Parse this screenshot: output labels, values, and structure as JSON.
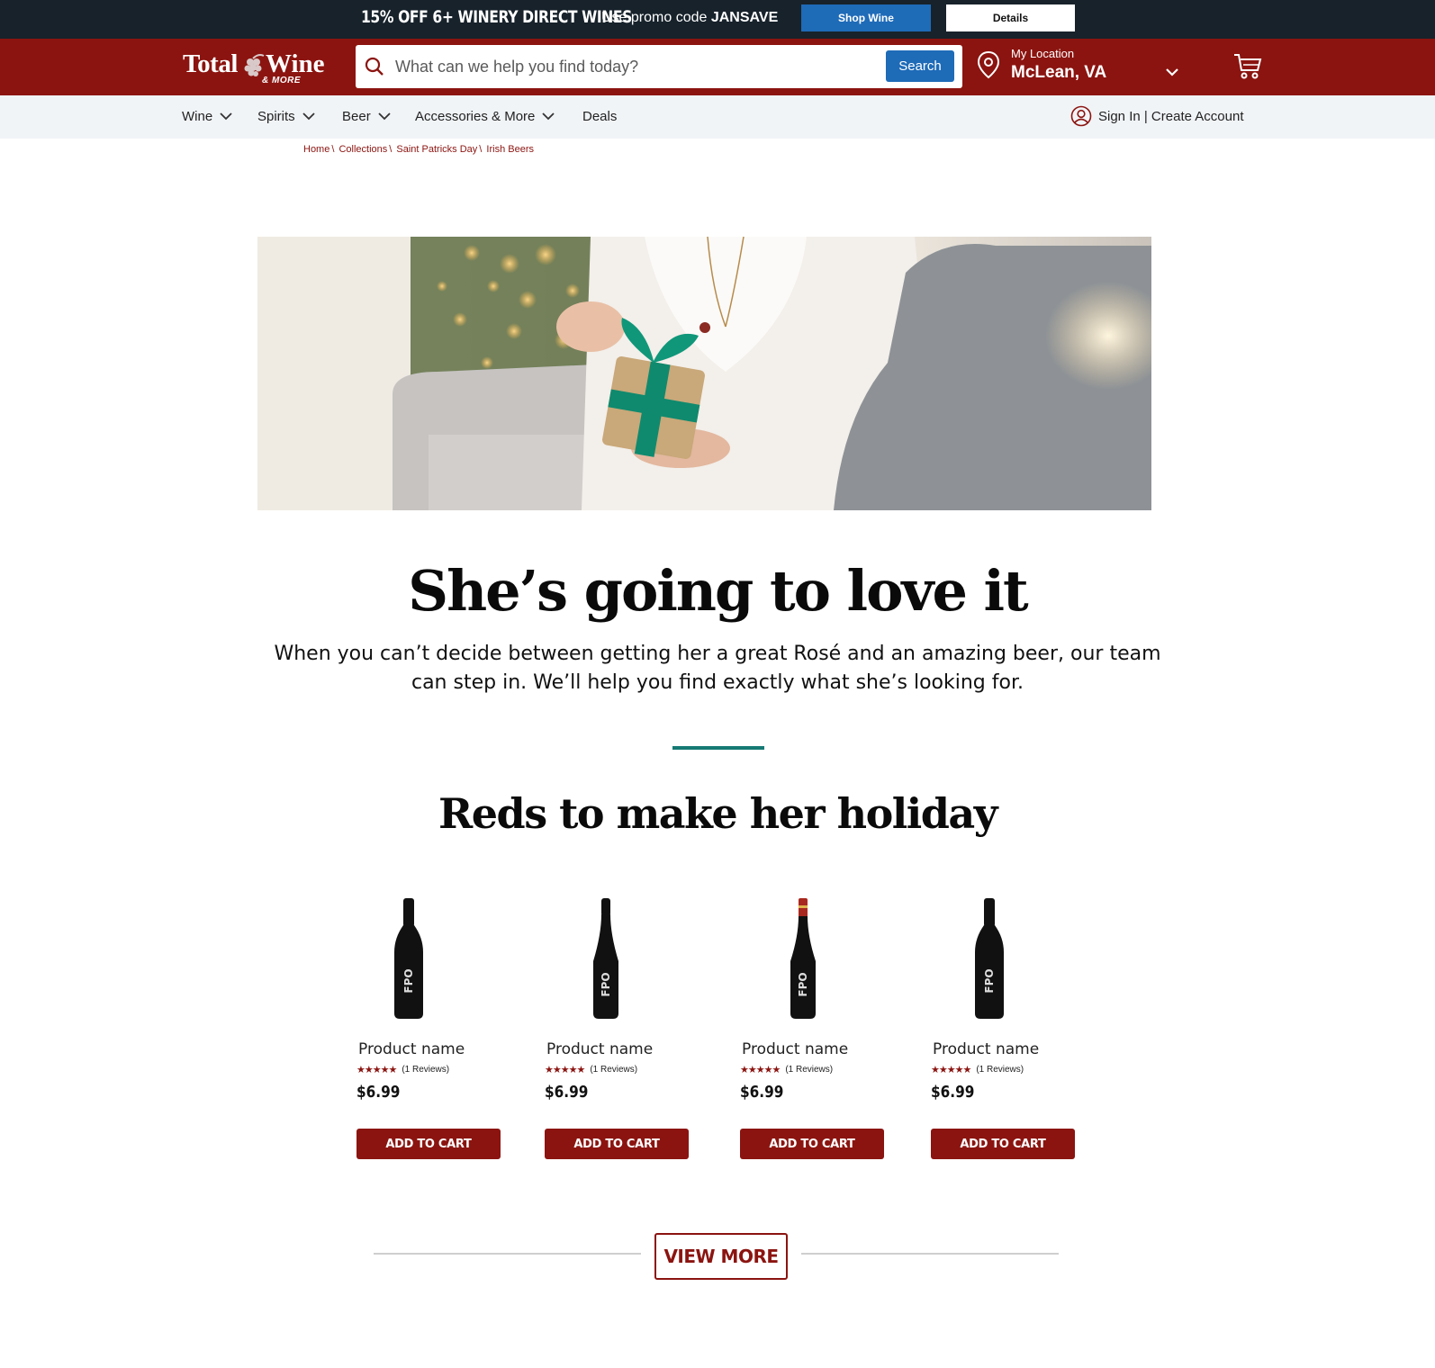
{
  "promo": {
    "headline": "15% OFF 6+ WINERY DIRECT WINES",
    "code_prefix": "Use promo code ",
    "code": "JANSAVE",
    "shop_label": "Shop Wine",
    "details_label": "Details"
  },
  "header": {
    "logo_total": "Total",
    "logo_wine": "Wine",
    "logo_more": "& MORE",
    "search_placeholder": "What can we help you find today?",
    "search_button": "Search",
    "location_label": "My Location",
    "location_value": "McLean, VA"
  },
  "nav": {
    "items": [
      {
        "label": "Wine"
      },
      {
        "label": "Spirits"
      },
      {
        "label": "Beer"
      },
      {
        "label": "Accessories & More"
      },
      {
        "label": "Deals"
      }
    ],
    "signin": "Sign In | Create Account"
  },
  "breadcrumb": [
    "Home",
    "Collections",
    "Saint Patricks Day",
    "Irish Beers"
  ],
  "hero": {
    "title": "She’s going to love it",
    "description": "When you can’t decide between getting her a great Rosé and an amazing beer, our team can step in. We’ll help you find exactly what she’s looking for."
  },
  "section": {
    "title": "Reds to make her holiday"
  },
  "products": [
    {
      "name": "Product name",
      "stars": "★★★★★",
      "reviews": "(1 Reviews)",
      "price": "$6.99",
      "button": "ADD TO CART",
      "bottle_label": "FPO"
    },
    {
      "name": "Product name",
      "stars": "★★★★★",
      "reviews": "(1 Reviews)",
      "price": "$6.99",
      "button": "ADD TO CART",
      "bottle_label": "FPO"
    },
    {
      "name": "Product name",
      "stars": "★★★★★",
      "reviews": "(1 Reviews)",
      "price": "$6.99",
      "button": "ADD TO CART",
      "bottle_label": "FPO"
    },
    {
      "name": "Product name",
      "stars": "★★★★★",
      "reviews": "(1 Reviews)",
      "price": "$6.99",
      "button": "ADD TO CART",
      "bottle_label": "FPO"
    }
  ],
  "view_more": "VIEW MORE",
  "colors": {
    "brand_red": "#8b1410",
    "promo_bg": "#17222b",
    "action_blue": "#1e6bb8",
    "accent_teal": "#157a73"
  }
}
